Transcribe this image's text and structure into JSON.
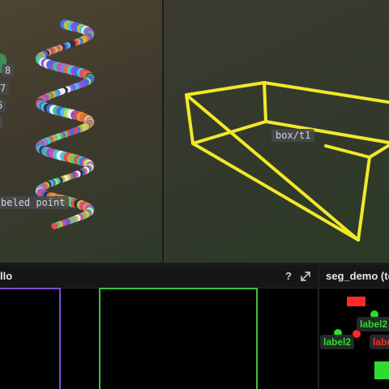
{
  "viewport_left": {
    "labels": {
      "point_label": "beled point"
    },
    "index_tags": [
      "8",
      "7",
      "6",
      "5"
    ]
  },
  "viewport_right": {
    "box_label": "box/t1",
    "box_color": "#f2e829"
  },
  "panel_main": {
    "title": "llo",
    "help_label": "?",
    "icons": {
      "expand": "expand-icon"
    },
    "rect_colors": [
      "#7b4fd0",
      "#3fbf3f"
    ]
  },
  "panel_segmentation": {
    "title": "seg_demo (te",
    "labels": [
      "label2",
      "label2",
      "labe"
    ],
    "colors": {
      "red": "#ff2a2a",
      "green": "#2edb2e"
    }
  }
}
